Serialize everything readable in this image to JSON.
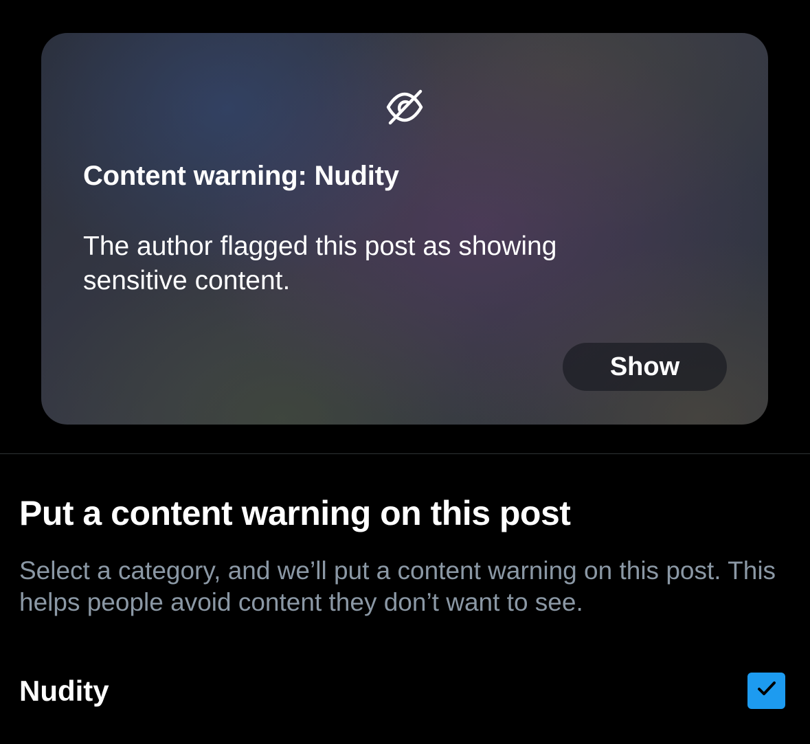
{
  "warning_card": {
    "icon": "eye-slash-icon",
    "title": "Content warning: Nudity",
    "description": "The author flagged this post as showing sensitive content.",
    "show_label": "Show"
  },
  "section": {
    "heading": "Put a content warning on this post",
    "description": "Select a category, and we’ll put a content warning on this post. This helps people avoid content they don’t want to see."
  },
  "options": [
    {
      "label": "Nudity",
      "checked": true,
      "icon": "checkmark-icon"
    }
  ],
  "colors": {
    "background": "#000000",
    "accent": "#1d9bf0",
    "muted_text": "#8b98a5",
    "divider": "#2f3336"
  }
}
